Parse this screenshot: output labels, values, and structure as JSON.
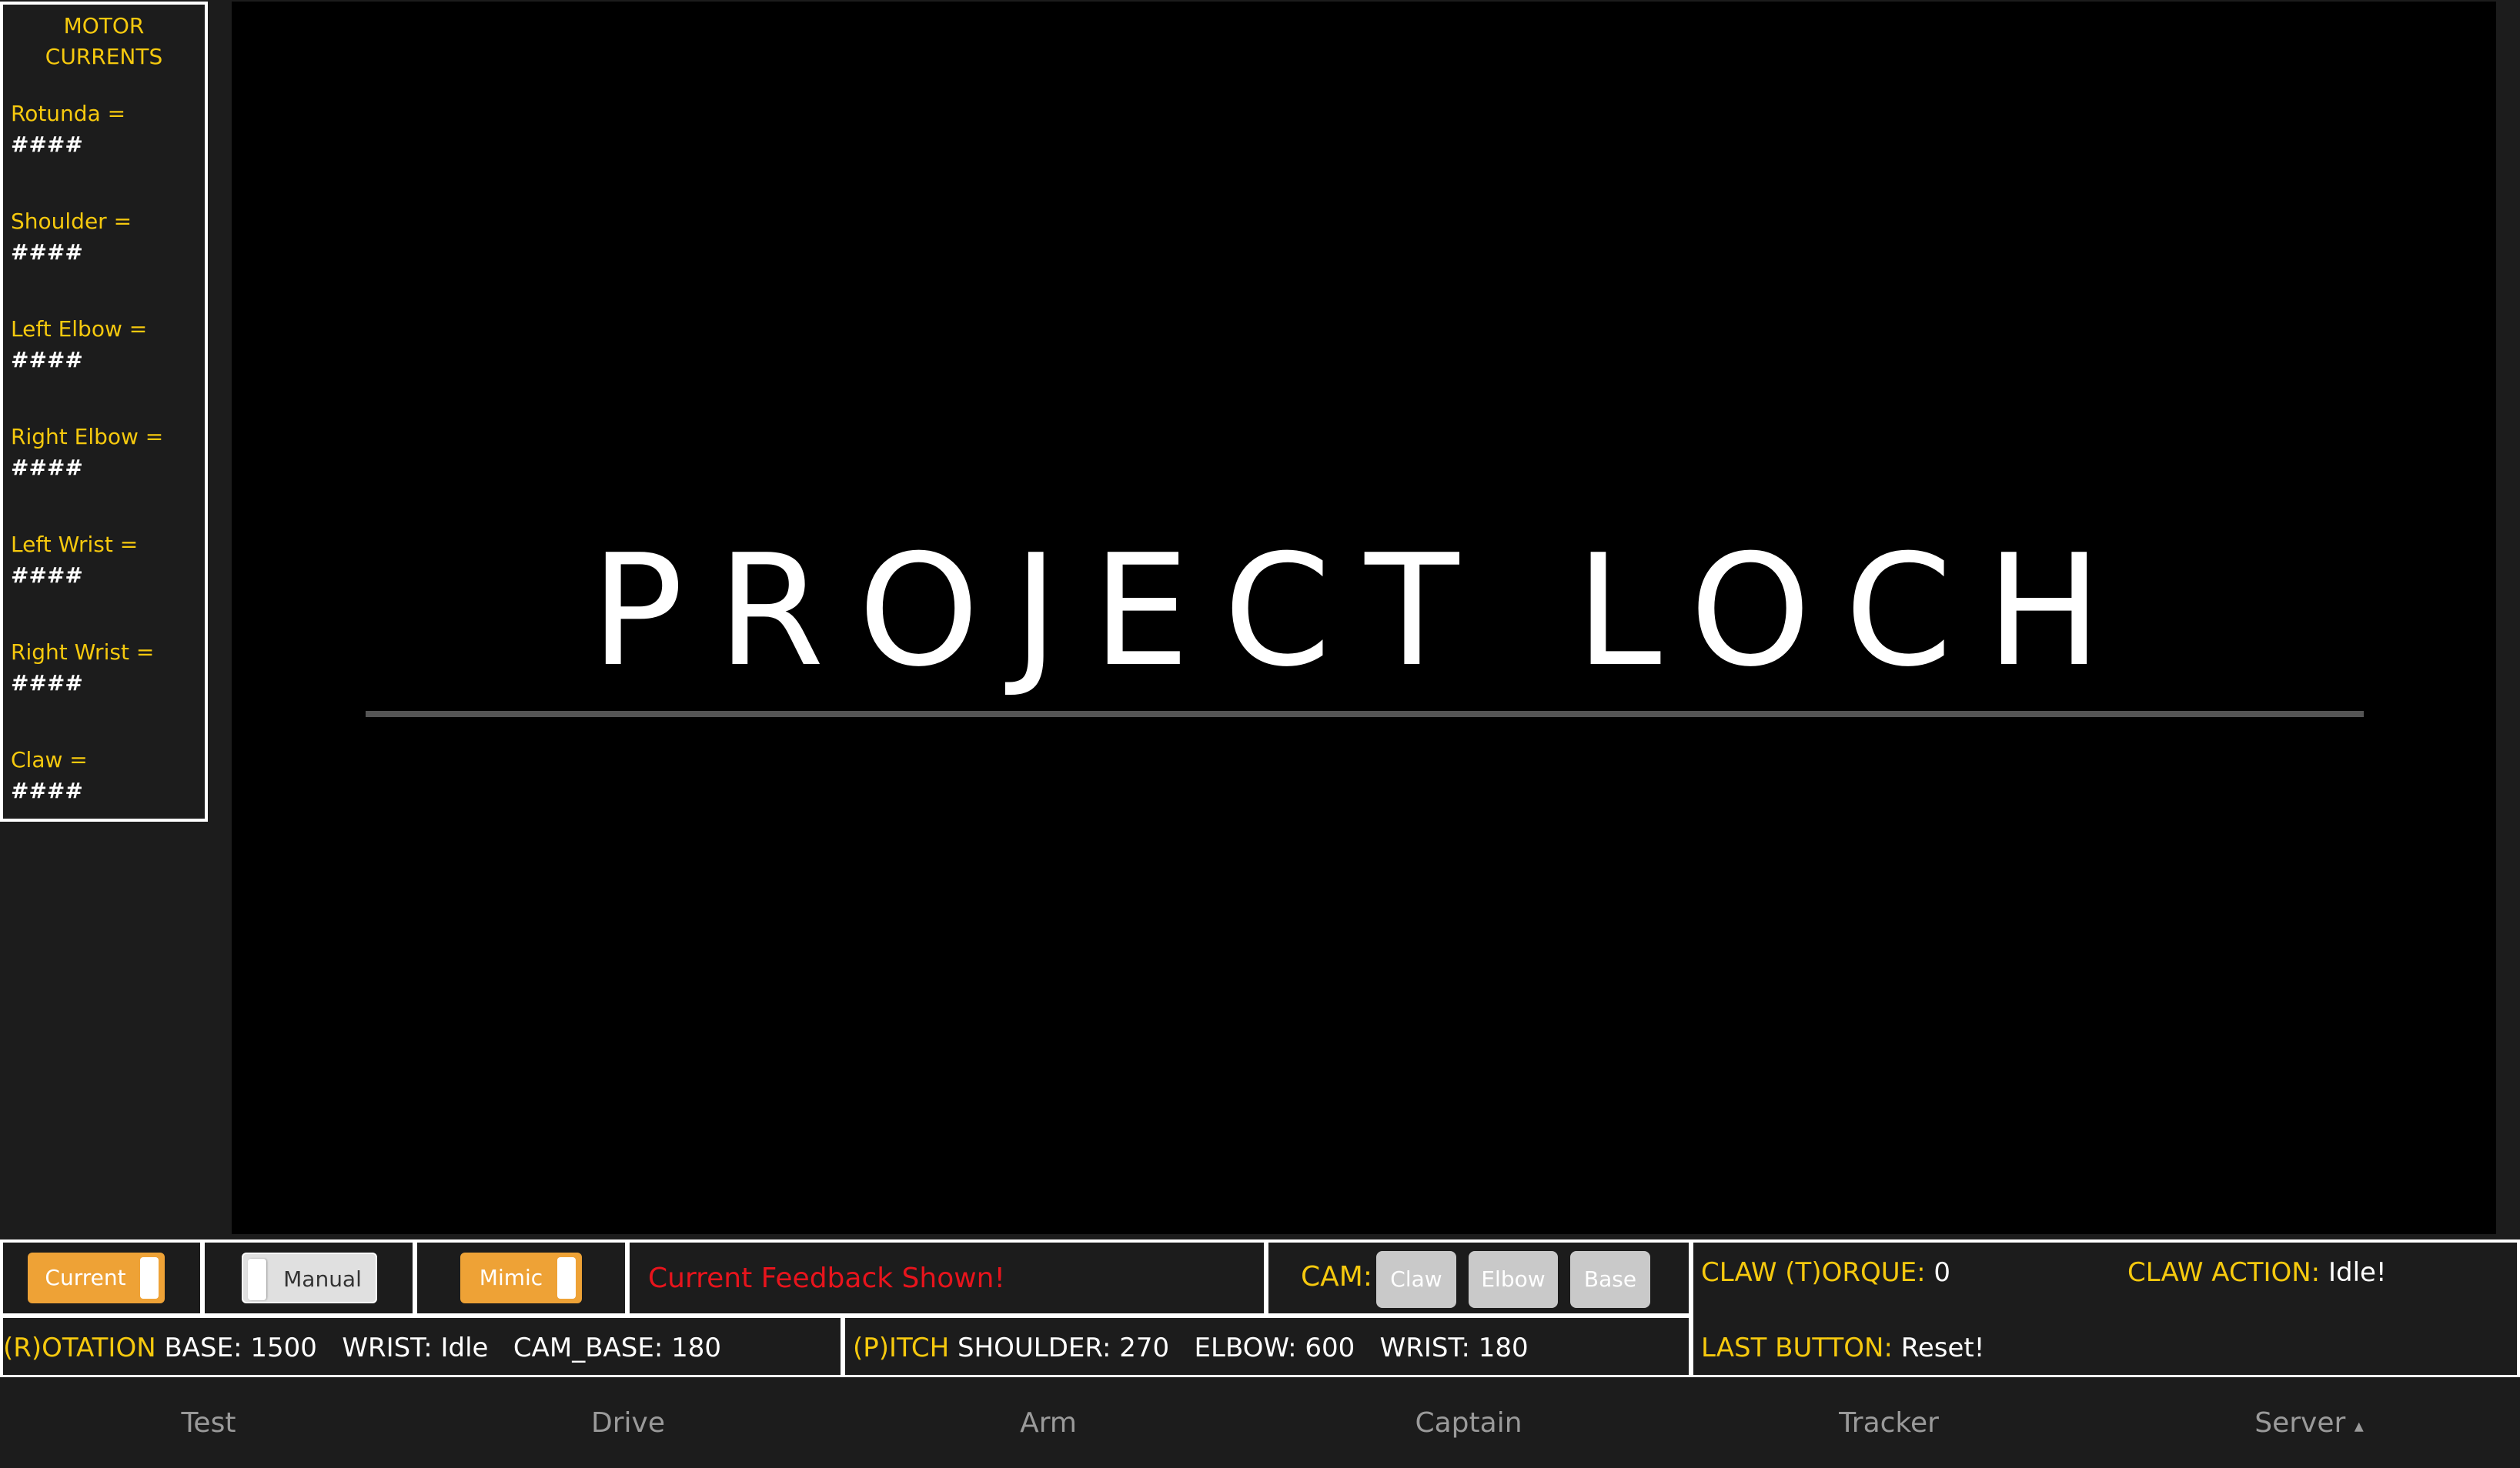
{
  "motor_panel": {
    "title_line1": "MOTOR",
    "title_line2": "CURRENTS",
    "motors": [
      {
        "label": "Rotunda =",
        "value": "####"
      },
      {
        "label": "Shoulder =",
        "value": "####"
      },
      {
        "label": "Left Elbow =",
        "value": "####"
      },
      {
        "label": "Right Elbow =",
        "value": "####"
      },
      {
        "label": "Left Wrist =",
        "value": "####"
      },
      {
        "label": "Right Wrist =",
        "value": "####"
      },
      {
        "label": "Claw =",
        "value": "####"
      }
    ]
  },
  "feed": {
    "logo_text": "PROJECT LOCH"
  },
  "controls": {
    "current_toggle": "Current",
    "manual_toggle": "Manual",
    "mimic_toggle": "Mimic",
    "feedback_status": "Current Feedback Shown!",
    "cam_label": "CAM:",
    "cam_buttons": [
      "Claw",
      "Elbow",
      "Base"
    ],
    "claw_torque_label": "CLAW (T)ORQUE:",
    "claw_torque_value": "0",
    "claw_action_label": "CLAW ACTION:",
    "claw_action_value": "Idle!",
    "last_button_label": "LAST BUTTON:",
    "last_button_value": "Reset!",
    "rotation_label": "(R)OTATION",
    "rotation_values": "BASE: 1500   WRIST: Idle   CAM_BASE: 180",
    "pitch_label": "(P)ITCH",
    "pitch_values": "SHOULDER: 270   ELBOW: 600   WRIST: 180"
  },
  "nav": {
    "items": [
      "Test",
      "Drive",
      "Arm",
      "Captain",
      "Tracker",
      "Server"
    ],
    "server_caret": "▴"
  },
  "colors": {
    "accent_yellow": "#f6c90e",
    "toggle_orange": "#eea236",
    "status_red": "#e8141c",
    "background": "#1c1c1c"
  }
}
